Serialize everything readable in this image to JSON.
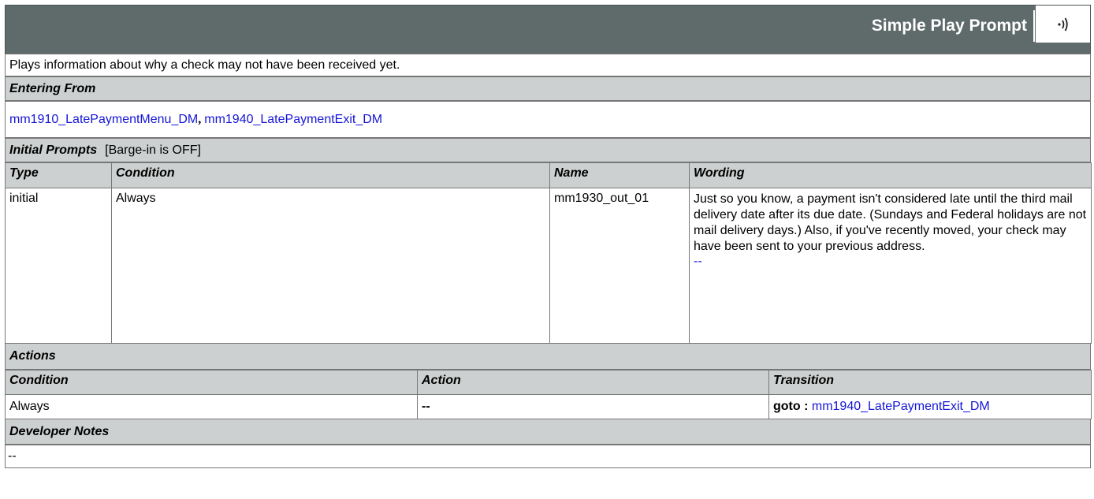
{
  "header": {
    "title": "Simple Play Prompt",
    "audio_icon": "speaker-icon"
  },
  "description": "Plays information about why a check may not have been received yet.",
  "entering_from": {
    "label": "Entering From",
    "links": [
      "mm1910_LatePaymentMenu_DM",
      "mm1940_LatePaymentExit_DM"
    ],
    "separator": ","
  },
  "initial_prompts": {
    "label": "Initial Prompts",
    "barge_in": "[Barge-in is OFF]",
    "columns": [
      "Type",
      "Condition",
      "Name",
      "Wording"
    ],
    "rows": [
      {
        "type": "initial",
        "condition": "Always",
        "name": "mm1930_out_01",
        "wording": "Just so you know, a payment isn't considered late until the third mail delivery date after its due date. (Sundays and Federal holidays are not mail delivery days.) Also, if you've recently moved, your check may have been sent to your previous address.",
        "wording_link": "--"
      }
    ]
  },
  "actions": {
    "label": "Actions",
    "columns": [
      "Condition",
      "Action",
      "Transition"
    ],
    "rows": [
      {
        "condition": "Always",
        "action": "--",
        "transition_prefix": "goto :",
        "transition_link": "mm1940_LatePaymentExit_DM"
      }
    ]
  },
  "developer_notes": {
    "label": "Developer Notes",
    "text": "--"
  }
}
